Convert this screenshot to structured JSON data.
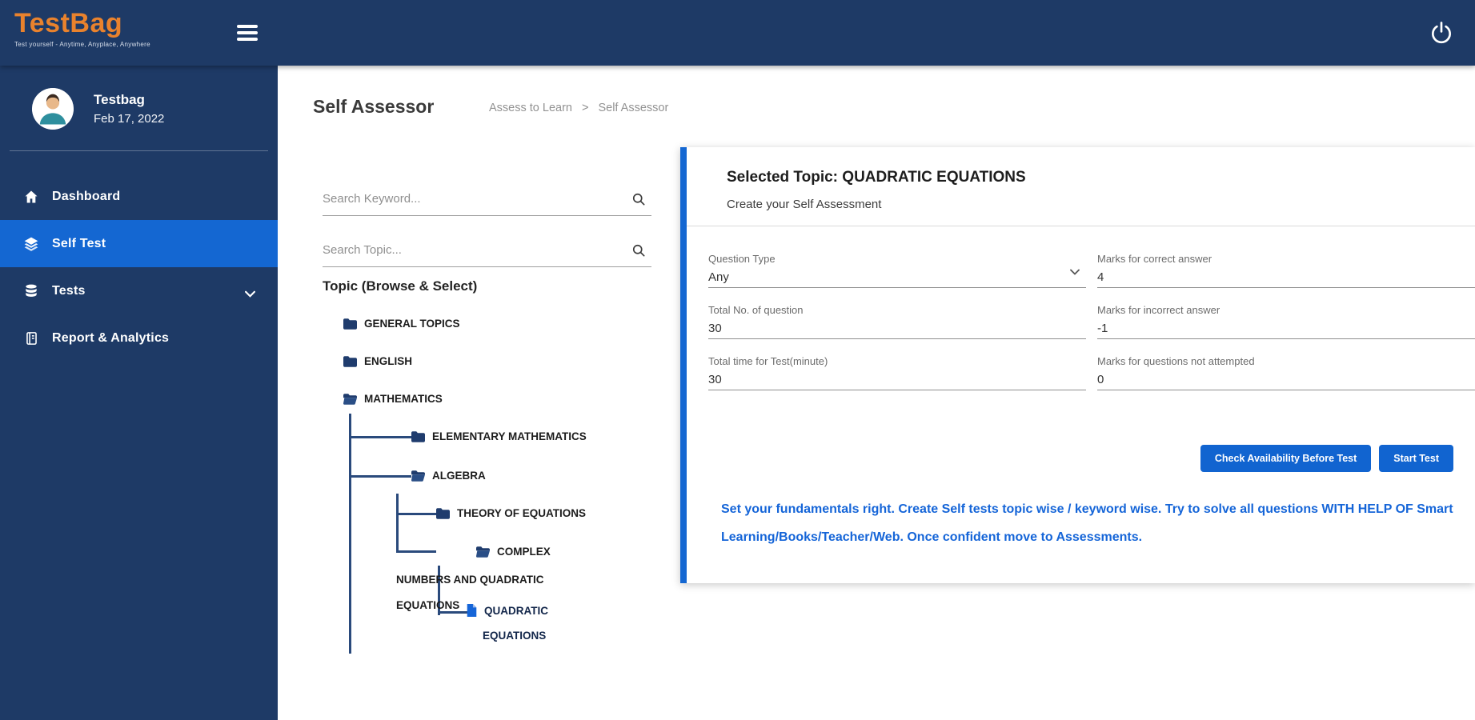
{
  "colors": {
    "navy": "#1e3a66",
    "active_blue": "#1467d2",
    "logo_orange": "#e9822d",
    "button_blue": "#1164d0",
    "note_blue": "#1565d8"
  },
  "topbar": {
    "logo": "TestBag",
    "tagline": "Test yourself - Anytime, Anyplace, Anywhere"
  },
  "sidebar": {
    "user": {
      "name": "Testbag",
      "date": "Feb 17, 2022"
    },
    "items": [
      {
        "label": "Dashboard",
        "active": false
      },
      {
        "label": "Self Test",
        "active": true
      },
      {
        "label": "Tests",
        "active": false
      },
      {
        "label": "Report & Analytics",
        "active": false
      }
    ]
  },
  "header": {
    "title": "Self Assessor",
    "breadcrumb": {
      "parent": "Assess to Learn",
      "separator": ">",
      "current": "Self Assessor"
    }
  },
  "topic_panel": {
    "search_keyword_placeholder": "Search Keyword...",
    "search_topic_placeholder": "Search Topic...",
    "heading": "Topic (Browse & Select)",
    "tree": {
      "items": [
        {
          "label": "GENERAL TOPICS"
        },
        {
          "label": "ENGLISH"
        },
        {
          "label": "MATHEMATICS"
        },
        {
          "label": "ELEMENTARY MATHEMATICS"
        },
        {
          "label": "ALGEBRA"
        },
        {
          "label": "THEORY OF EQUATIONS"
        },
        {
          "label": "COMPLEX NUMBERS AND QUADRATIC EQUATIONS"
        },
        {
          "label": "QUADRATIC EQUATIONS"
        }
      ]
    }
  },
  "assessment": {
    "title": "Selected Topic: QUADRATIC EQUATIONS",
    "subtitle": "Create your Self Assessment",
    "fields": [
      {
        "label": "Question Type",
        "value": "Any"
      },
      {
        "label": "Marks for correct answer",
        "value": "4"
      },
      {
        "label": "Total No. of question",
        "value": "30"
      },
      {
        "label": "Marks for incorrect answer",
        "value": "-1"
      },
      {
        "label": "Total time for Test(minute)",
        "value": "30"
      },
      {
        "label": "Marks for questions not attempted",
        "value": "0"
      }
    ],
    "buttons": {
      "check": "Check Availability Before Test",
      "start": "Start Test"
    },
    "note": "Set your fundamentals right. Create Self tests topic wise / keyword wise. Try to solve all questions WITH HELP OF Smart Learning/Books/Teacher/Web. Once confident move to Assessments."
  }
}
